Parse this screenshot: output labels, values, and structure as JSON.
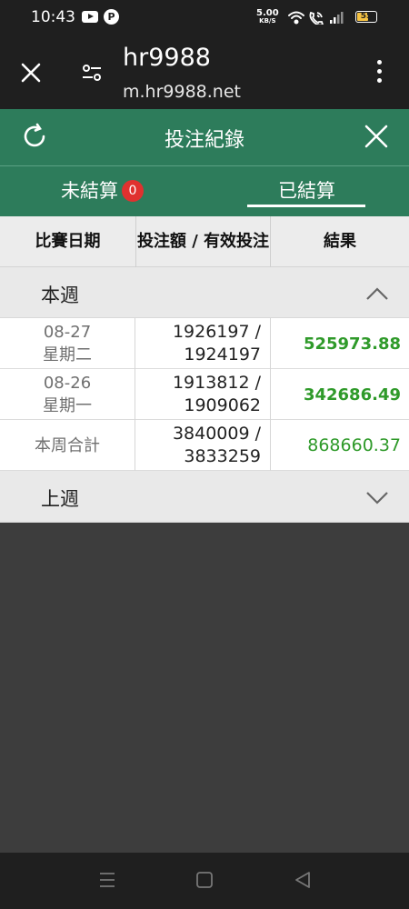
{
  "status_bar": {
    "time": "10:43",
    "net_speed_value": "5.00",
    "net_speed_unit": "KB/S",
    "battery": "55",
    "icons": [
      "youtube-icon",
      "p-app-icon",
      "wifi-icon",
      "wifi-call-icon",
      "signal-icon",
      "battery-icon"
    ]
  },
  "browser": {
    "title": "hr9988",
    "url": "m.hr9988.net"
  },
  "modal": {
    "title": "投注紀錄"
  },
  "tabs": [
    {
      "label": "未結算",
      "badge": "0",
      "active": false
    },
    {
      "label": "已結算",
      "active": true
    }
  ],
  "table": {
    "headers": [
      "比賽日期",
      "投注額 / 有效投注",
      "結果"
    ]
  },
  "this_week": {
    "label": "本週",
    "expanded": true,
    "rows": [
      {
        "date": "08-27",
        "weekday": "星期二",
        "stake": "1926197 /",
        "valid": "1924197",
        "result": "525973.88"
      },
      {
        "date": "08-26",
        "weekday": "星期一",
        "stake": "1913812 /",
        "valid": "1909062",
        "result": "342686.49"
      }
    ],
    "total": {
      "label": "本周合計",
      "stake": "3840009 /",
      "valid": "3833259",
      "result": "868660.37"
    }
  },
  "last_week": {
    "label": "上週",
    "expanded": false
  },
  "colors": {
    "header_green": "#2d7c5b",
    "result_green": "#2f9a2a",
    "badge_red": "#e0312f"
  }
}
